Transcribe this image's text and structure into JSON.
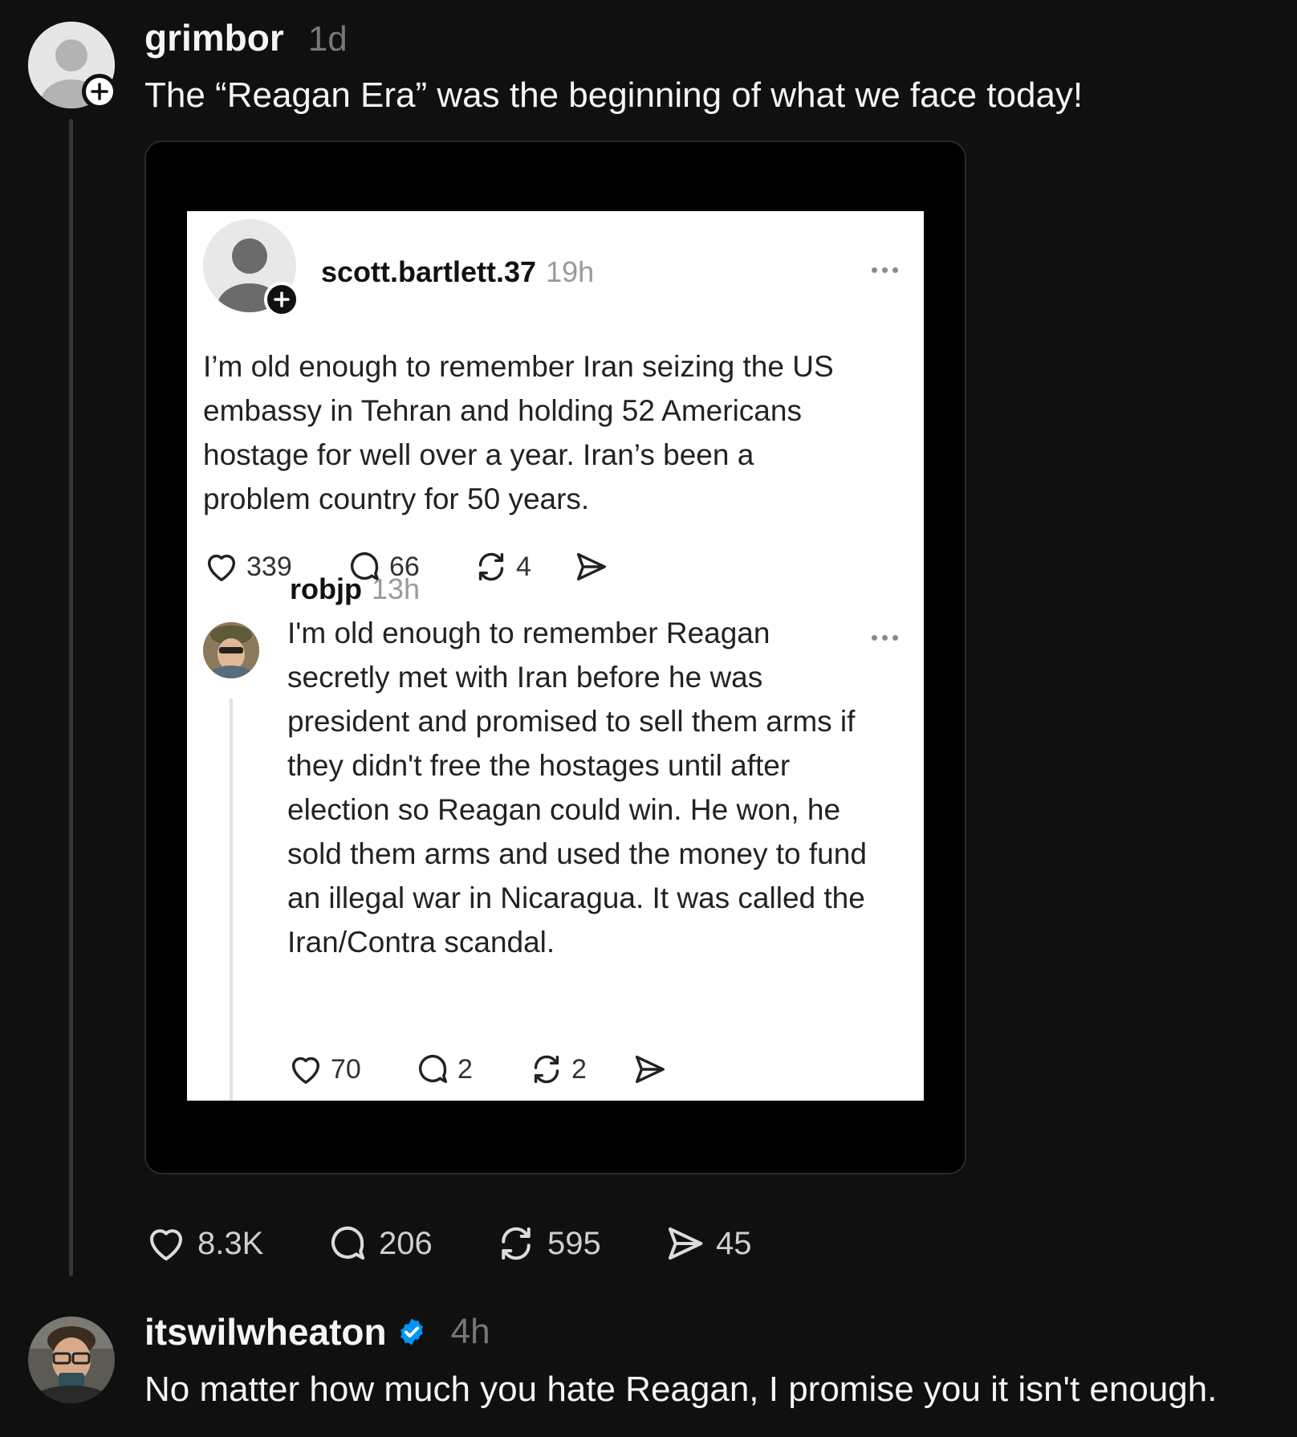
{
  "post": {
    "author": "grimbor",
    "time": "1d",
    "text": "The “Reagan Era” was the beginning of what we face today!",
    "stats": {
      "likes": "8.3K",
      "comments": "206",
      "reposts": "595",
      "shares": "45"
    }
  },
  "embedded": {
    "post": {
      "author": "scott.bartlett.37",
      "time": "19h",
      "lines": [
        "I’m old enough to remember Iran seizing the US",
        "embassy in Tehran and holding 52 Americans",
        "hostage for well over a year.  Iran’s been a",
        "problem country for 50 years."
      ],
      "stats": {
        "likes": "339",
        "comments": "66",
        "reposts": "4"
      }
    },
    "reply": {
      "author": "robjp",
      "time": "13h",
      "lines": [
        "I'm old enough to remember Reagan",
        "secretly met with Iran before he was",
        "president and promised to sell them arms if",
        "they didn't free the hostages until after",
        "election so Reagan could win. He won, he",
        "sold them arms and used the money to fund",
        "an illegal war in Nicaragua. It was called the",
        "Iran/Contra scandal."
      ],
      "stats": {
        "likes": "70",
        "comments": "2",
        "reposts": "2"
      }
    }
  },
  "reply": {
    "author": "itswilwheaton",
    "time": "4h",
    "text": "No matter how much you hate Reagan, I promise you it isn't enough."
  },
  "colors": {
    "background": "#101010",
    "verified": "#0095f6"
  }
}
